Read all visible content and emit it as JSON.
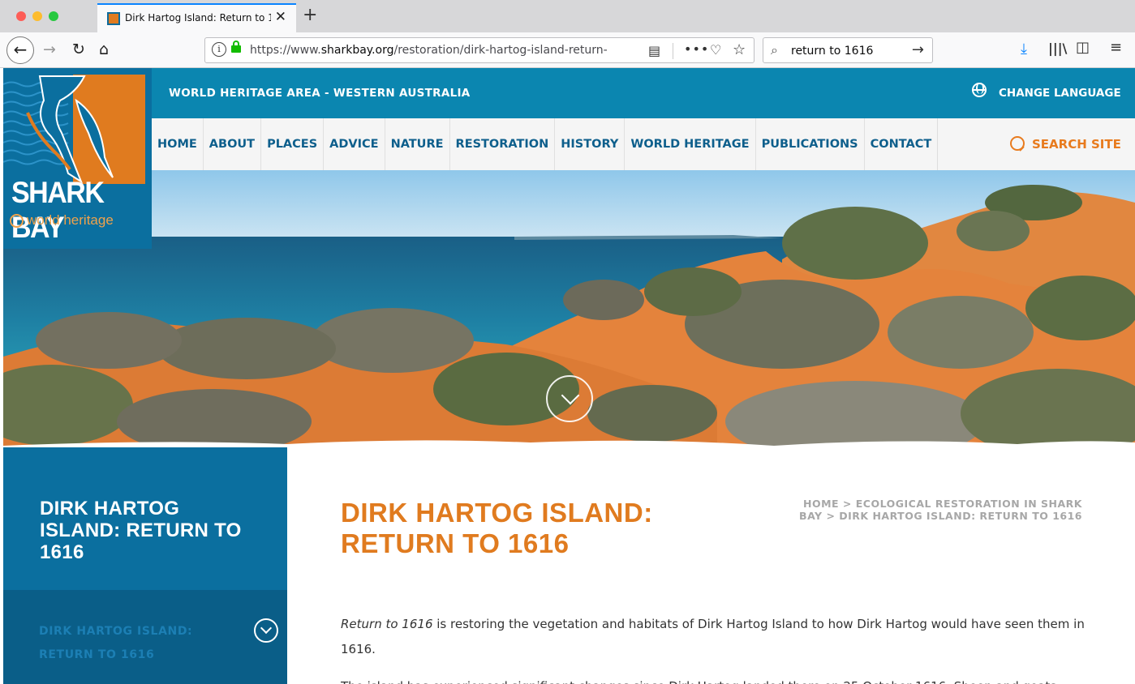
{
  "browser": {
    "tab_title": "Dirk Hartog Island: Return to 1616",
    "url_prefix": "https://www.",
    "url_host": "sharkbay.org",
    "url_path": "/restoration/dirk-hartog-island-return-",
    "search_value": "return to 1616",
    "accent_color": "#0a84ff"
  },
  "site": {
    "topbar_title": "WORLD HERITAGE AREA - WESTERN AUSTRALIA",
    "change_language": "CHANGE LANGUAGE",
    "nav": [
      "HOME",
      "ABOUT",
      "PLACES",
      "ADVICE",
      "NATURE",
      "RESTORATION",
      "HISTORY",
      "WORLD HERITAGE",
      "PUBLICATIONS",
      "CONTACT"
    ],
    "search_label": "SEARCH SITE",
    "logo": {
      "title": "SHARK BAY",
      "subtitle": "world heritage"
    },
    "colors": {
      "blue": "#0b86b0",
      "dark_blue": "#0b6f9f",
      "orange": "#e07b1f"
    }
  },
  "sidebar": {
    "title": "DIRK HARTOG ISLAND: RETURN TO 1616",
    "sub_item": "DIRK HARTOG ISLAND: RETURN TO 1616"
  },
  "content": {
    "heading": "DIRK HARTOG ISLAND: RETURN TO 1616",
    "breadcrumb": "HOME > ECOLOGICAL RESTORATION IN SHARK BAY > DIRK HARTOG ISLAND: RETURN TO 1616",
    "para1_em": "Return to 1616",
    "para1_rest": " is restoring the vegetation and habitats of Dirk Hartog Island to how Dirk Hartog would have seen them in 1616.",
    "para2": "The island has experienced significant changes since Dirk Hartog landed there on 25 October 1616. Sheep and goats"
  }
}
